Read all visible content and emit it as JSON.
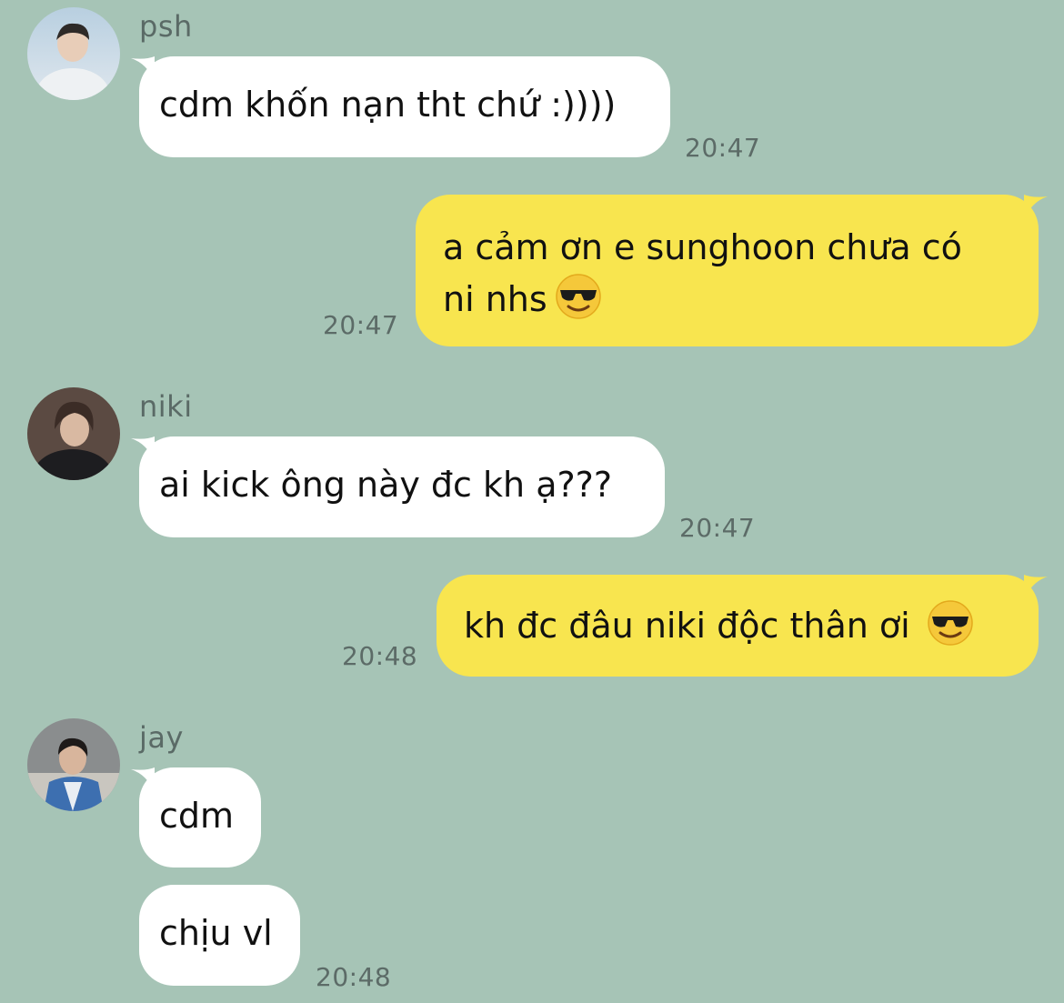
{
  "messages": [
    {
      "sender": "psh",
      "text": "cdm khốn nạn tht chứ :))))",
      "time": "20:47"
    },
    {
      "text_line1": "a cảm ơn e sunghoon chưa có",
      "text_line2": "ni nhs",
      "emoji": "smiling-face-with-sunglasses",
      "time": "20:47"
    },
    {
      "sender": "niki",
      "text": "ai kick ông này đc kh ạ???",
      "time": "20:47"
    },
    {
      "text": "kh đc đâu niki độc thân ơi",
      "emoji": "smiling-face-with-sunglasses",
      "time": "20:48"
    },
    {
      "sender": "jay",
      "text": "cdm"
    },
    {
      "text": "chịu vl",
      "time": "20:48"
    }
  ],
  "colors": {
    "background": "#a6c4b6",
    "incoming_bubble": "#ffffff",
    "outgoing_bubble": "#f8e54f",
    "meta_text": "#5c6b67"
  }
}
